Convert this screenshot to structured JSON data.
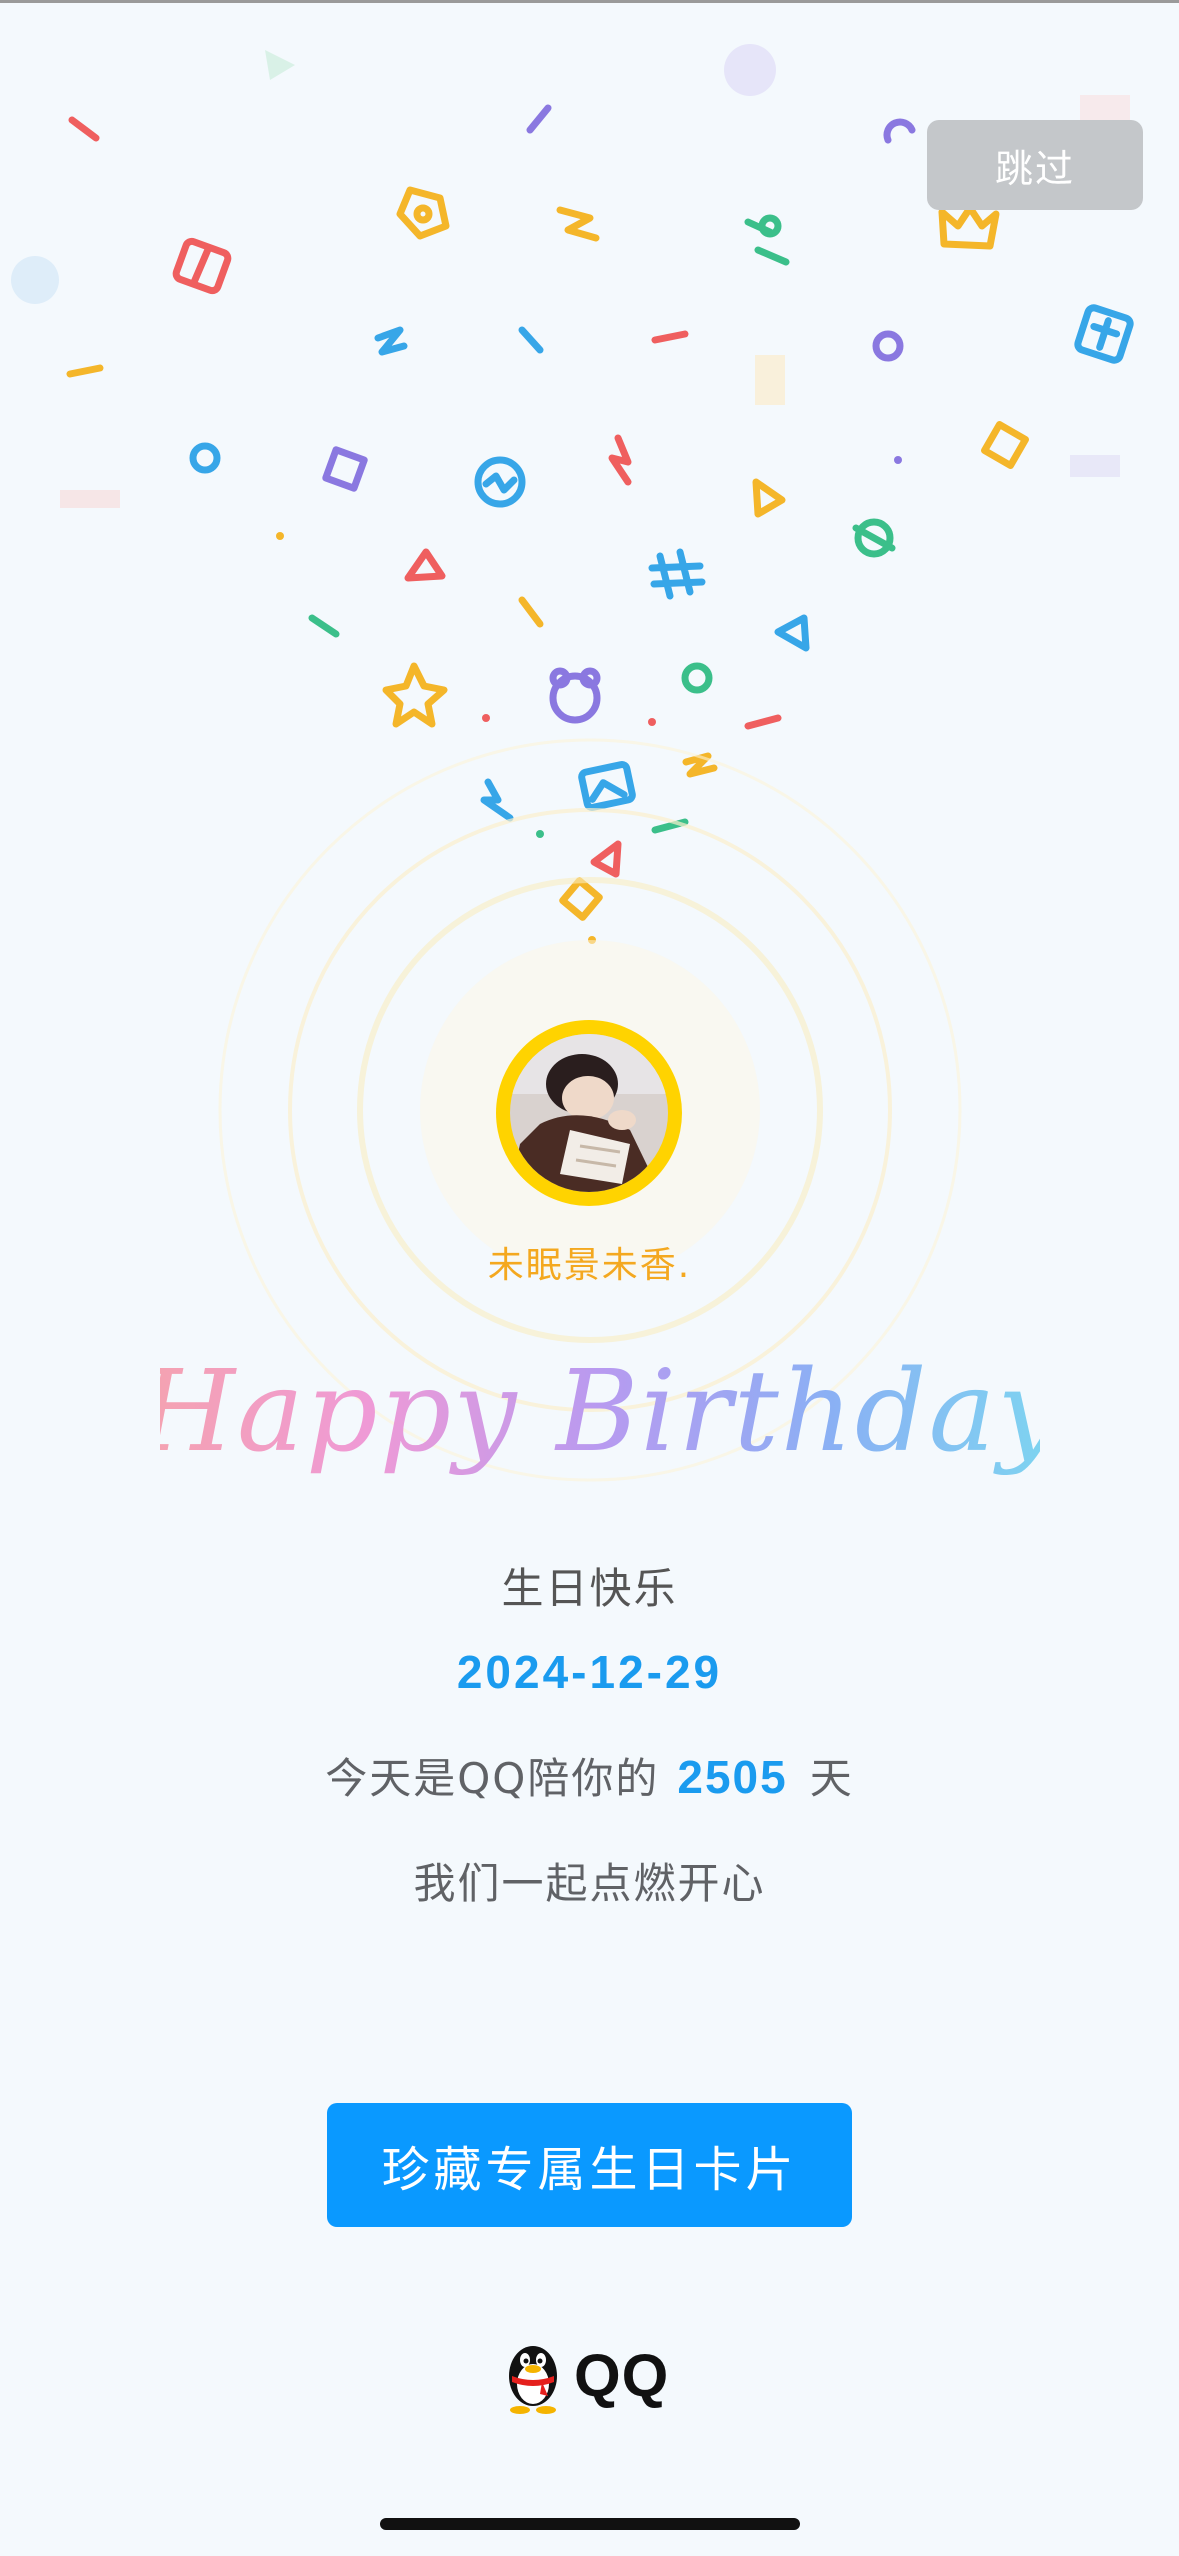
{
  "skip": {
    "label": "跳过"
  },
  "user": {
    "nickname": "未眠景未香."
  },
  "greeting": {
    "headline": "Happy Birthday",
    "subtitle": "生日快乐",
    "date": "2024-12-29",
    "days_prefix": "今天是QQ陪你的",
    "days_count": "2505",
    "days_suffix": "天",
    "together": "我们一起点燃开心"
  },
  "cta": {
    "label": "珍藏专属生日卡片"
  },
  "brand": {
    "name": "QQ"
  },
  "colors": {
    "accent": "#0a99ff",
    "date": "#1a9bef",
    "nickname": "#f4a81f",
    "avatar_ring": "#ffd300",
    "skip_bg": "#c4c7ca"
  },
  "icons": [
    "confetti",
    "avatar-photo",
    "qq-penguin-icon"
  ]
}
